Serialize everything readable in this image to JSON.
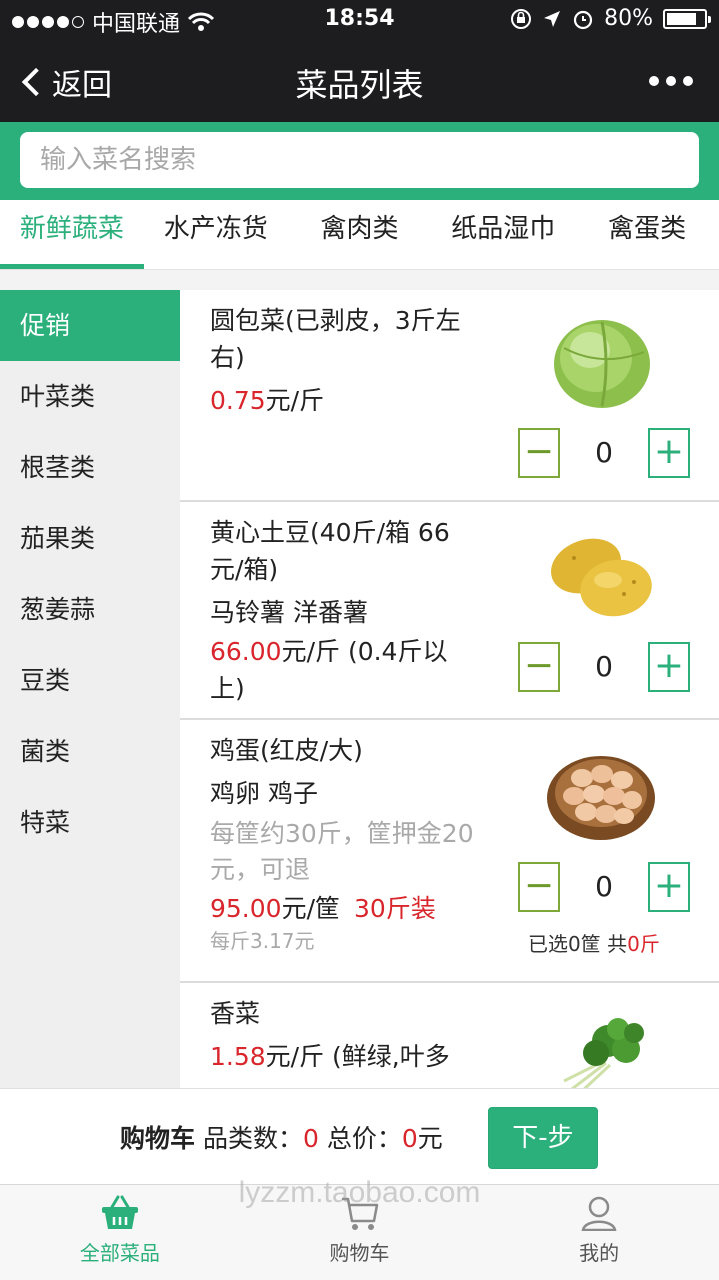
{
  "status_bar": {
    "carrier": "中国联通",
    "time": "18:54",
    "battery": "80%",
    "battery_level": 0.8
  },
  "nav": {
    "back_label": "返回",
    "title": "菜品列表"
  },
  "search": {
    "placeholder": "输入菜名搜索"
  },
  "category_tabs": [
    {
      "label": "新鲜蔬菜",
      "active": true
    },
    {
      "label": "水产冻货"
    },
    {
      "label": "禽肉类"
    },
    {
      "label": "纸品湿巾"
    },
    {
      "label": "禽蛋类"
    }
  ],
  "sidebar": {
    "items": [
      {
        "label": "促销",
        "active": true
      },
      {
        "label": "叶菜类"
      },
      {
        "label": "根茎类"
      },
      {
        "label": "茄果类"
      },
      {
        "label": "葱姜蒜"
      },
      {
        "label": "豆类"
      },
      {
        "label": "菌类"
      },
      {
        "label": "特菜"
      }
    ]
  },
  "products": [
    {
      "name": "圆包菜(已剥皮，3斤左右)",
      "price": "0.75",
      "unit": "元/斤",
      "quantity": "0",
      "image": "cabbage"
    },
    {
      "name": "黄心土豆(40斤/箱 66元/箱)",
      "alias": "马铃薯 洋番薯",
      "price": "66.00",
      "unit": "元/斤 (0.4斤以上)",
      "quantity": "0",
      "image": "potato"
    },
    {
      "name": "鸡蛋(红皮/大)",
      "alias": "鸡卵 鸡子",
      "note": "每筐约30斤，筐押金20元，可退",
      "price": "95.00",
      "unit": "元/筐",
      "pack": "30斤装",
      "subprice": "每斤3.17元",
      "quantity": "0",
      "selected_label": "已选0筐  共",
      "selected_weight": "0斤",
      "image": "eggs"
    },
    {
      "name": "香菜",
      "price": "1.58",
      "unit": "元/斤 (鲜绿,叶多",
      "image": "coriander"
    }
  ],
  "cart": {
    "title": "购物车",
    "kinds_label": "品类数：",
    "kinds": "0",
    "total_label": "总价：",
    "total": "0",
    "currency": "元",
    "next_label": "下-步"
  },
  "tabbar": [
    {
      "label": "全部菜品",
      "icon": "basket-icon",
      "active": true
    },
    {
      "label": "购物车",
      "icon": "cart-icon"
    },
    {
      "label": "我的",
      "icon": "user-icon"
    }
  ],
  "watermark": "lyzzm.taobao.com",
  "colors": {
    "accent": "#2bb07c",
    "price": "#d9262c",
    "topbar": "#1d1d1f"
  }
}
